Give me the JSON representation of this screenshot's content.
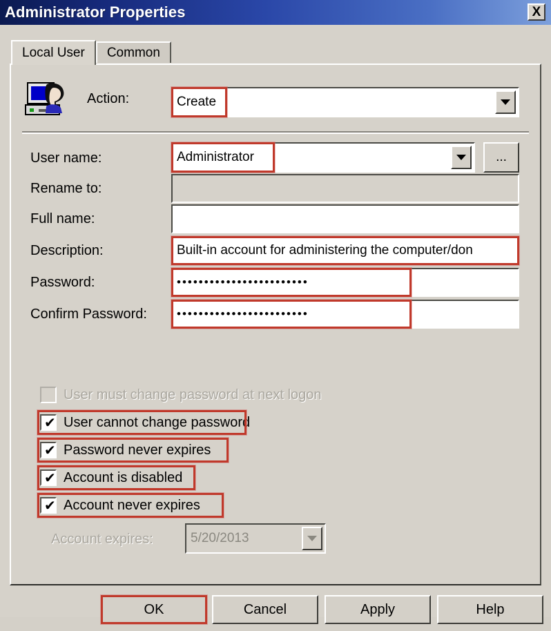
{
  "window": {
    "title": "Administrator Properties",
    "close_label": "X"
  },
  "tabs": [
    {
      "label": "Local User",
      "active": true
    },
    {
      "label": "Common",
      "active": false
    }
  ],
  "action": {
    "label": "Action:",
    "value": "Create",
    "icon": "local-user-computer-icon",
    "highlighted": true
  },
  "fields": {
    "user_name": {
      "label": "User name:",
      "value": "Administrator",
      "browse_label": "...",
      "highlighted": true,
      "disabled": false
    },
    "rename_to": {
      "label": "Rename to:",
      "value": "",
      "highlighted": false,
      "disabled": true
    },
    "full_name": {
      "label": "Full name:",
      "value": "",
      "highlighted": false,
      "disabled": false
    },
    "description": {
      "label": "Description:",
      "value": "Built-in account for administering the computer/don",
      "highlighted": true,
      "disabled": false
    },
    "password": {
      "label": "Password:",
      "value": "••••••••••••••••••••••••",
      "highlighted": true,
      "disabled": false
    },
    "confirm_password": {
      "label": "Confirm Password:",
      "value": "••••••••••••••••••••••••",
      "highlighted": true,
      "disabled": false
    }
  },
  "checkboxes": [
    {
      "label": "User must change password at next logon",
      "checked": false,
      "disabled": true,
      "highlighted": false
    },
    {
      "label": "User cannot change password",
      "checked": true,
      "disabled": false,
      "highlighted": true
    },
    {
      "label": "Password never expires",
      "checked": true,
      "disabled": false,
      "highlighted": true
    },
    {
      "label": "Account is disabled",
      "checked": true,
      "disabled": false,
      "highlighted": true
    },
    {
      "label": "Account never expires",
      "checked": true,
      "disabled": false,
      "highlighted": true
    }
  ],
  "account_expires": {
    "label": "Account expires:",
    "value": "5/20/2013",
    "disabled": true
  },
  "buttons": [
    {
      "label": "OK",
      "highlighted": true
    },
    {
      "label": "Cancel",
      "highlighted": false
    },
    {
      "label": "Apply",
      "highlighted": false
    },
    {
      "label": "Help",
      "highlighted": false
    }
  ],
  "colors": {
    "highlight": "#c0392b",
    "dialog_face": "#d6d2ca",
    "title_start": "#0b1a50",
    "title_end": "#7da0dc"
  },
  "checkmark": "✔"
}
